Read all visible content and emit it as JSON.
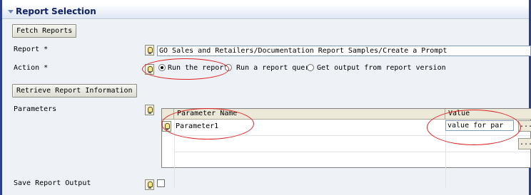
{
  "section": {
    "title": "Report Selection"
  },
  "buttons": {
    "fetch_reports": "Fetch Reports",
    "retrieve_info": "Retrieve Report Information"
  },
  "fields": {
    "report_label": "Report *",
    "report_value": "GO Sales and Retailers/Documentation Report Samples/Create a Prompt",
    "action_label": "Action *",
    "parameters_label": "Parameters",
    "save_output_label": "Save Report Output"
  },
  "action_options": [
    {
      "label": "Run the report",
      "selected": true
    },
    {
      "label": "Run a report query",
      "selected": false
    },
    {
      "label": "Get output from report version",
      "selected": false
    }
  ],
  "parameters_table": {
    "columns": [
      "Parameter Name",
      "Value"
    ],
    "rows": [
      {
        "name": "Parameter1",
        "value": "value for par"
      }
    ],
    "ellipsis": "..."
  },
  "save_output": {
    "checked": false
  },
  "colors": {
    "frame": "#2a3f8f",
    "header_text": "#10206a",
    "annotation": "#e02020"
  }
}
